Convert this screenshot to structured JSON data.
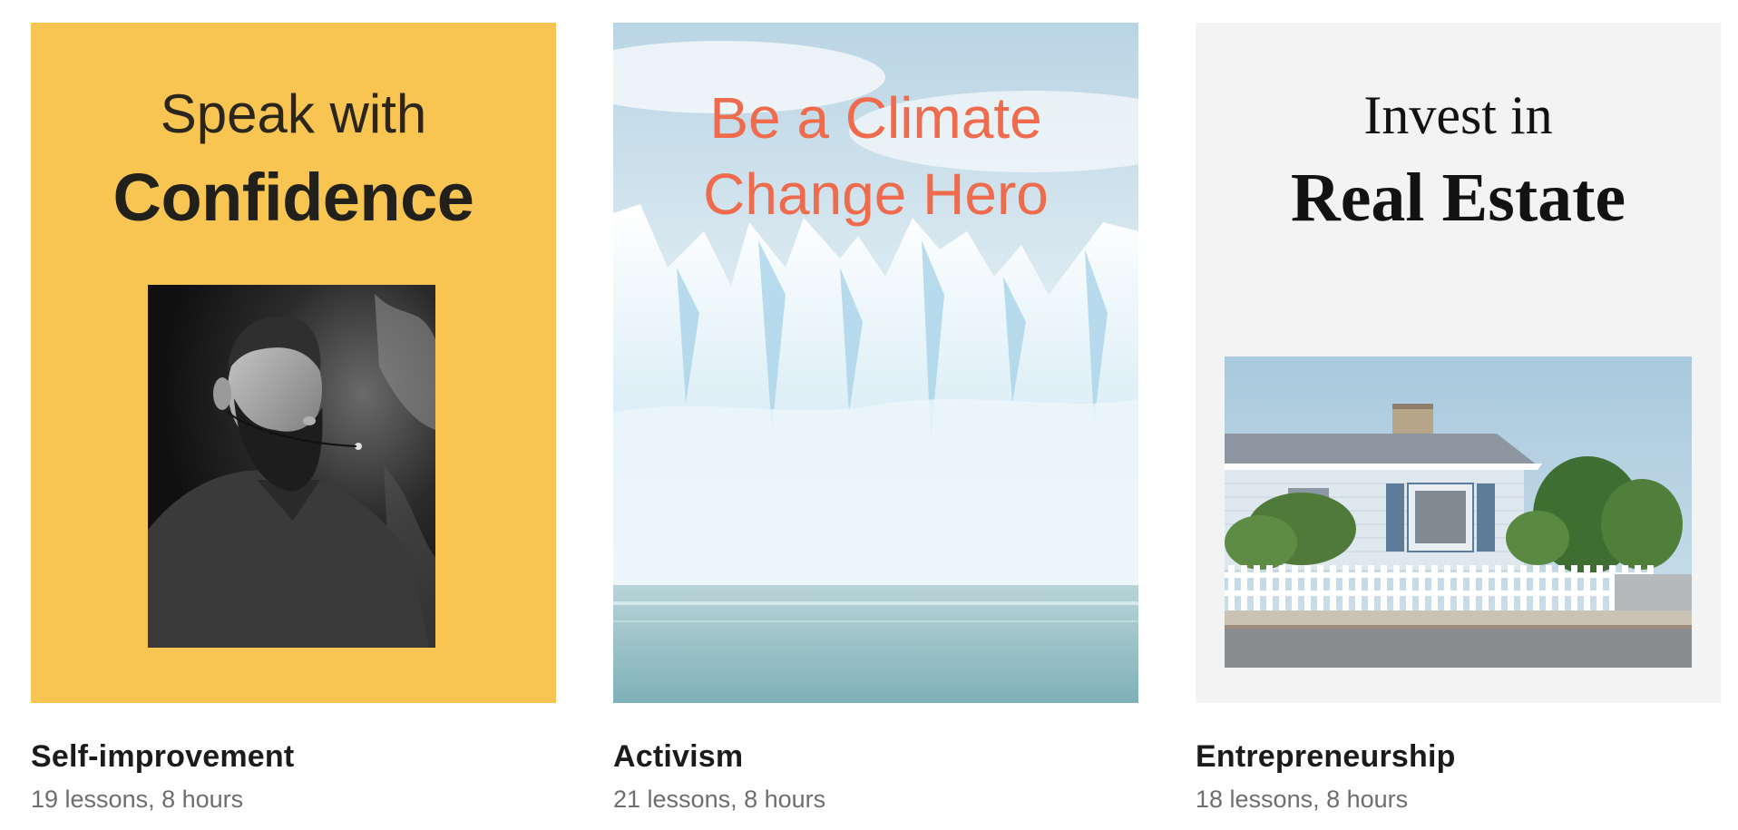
{
  "courses": [
    {
      "cover": {
        "line1": "Speak with",
        "line2": "Confidence",
        "background_color": "#f8c452",
        "image": "speaker-portrait-bw"
      },
      "category": "Self-improvement",
      "details": "19 lessons, 8 hours"
    },
    {
      "cover": {
        "line1": "Be a Climate",
        "line2": "Change Hero",
        "title_color": "#ee6b4d",
        "image": "glacier-and-sea"
      },
      "category": "Activism",
      "details": "21 lessons, 8 hours"
    },
    {
      "cover": {
        "line1": "Invest in",
        "line2": "Real Estate",
        "background_color": "#f3f3f3",
        "image": "house-with-picket-fence"
      },
      "category": "Entrepreneurship",
      "details": "18 lessons, 8 hours"
    }
  ]
}
